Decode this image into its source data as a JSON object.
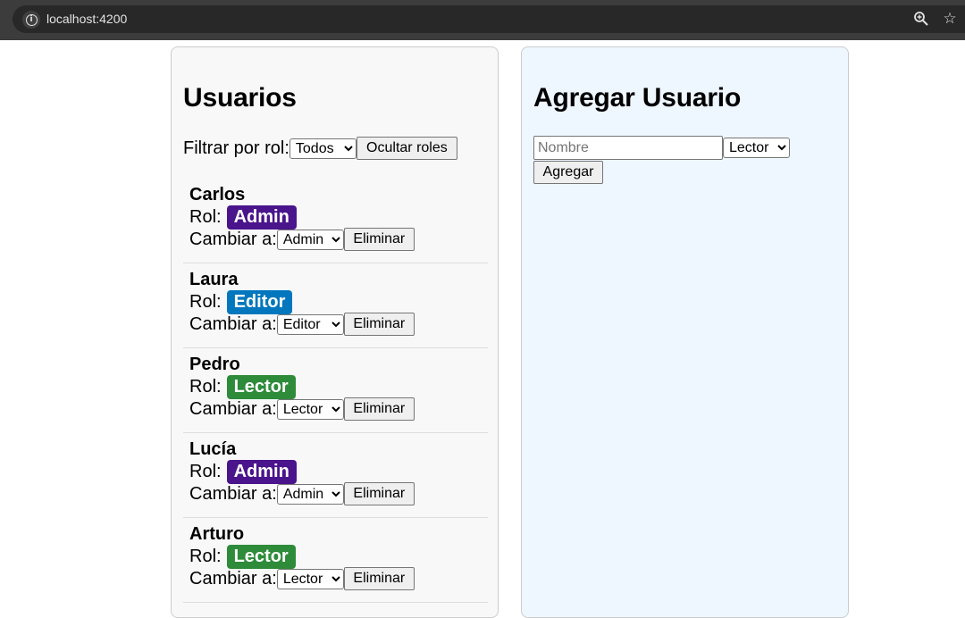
{
  "browser": {
    "url": "localhost:4200"
  },
  "users_panel": {
    "title": "Usuarios",
    "filter_label": "Filtrar por rol:",
    "filter_value": "Todos",
    "toggle_roles_label": "Ocultar roles",
    "role_prefix": "Rol:",
    "change_prefix": "Cambiar a:",
    "delete_label": "Eliminar",
    "users": [
      {
        "name": "Carlos",
        "role": "Admin",
        "role_key": "admin"
      },
      {
        "name": "Laura",
        "role": "Editor",
        "role_key": "editor"
      },
      {
        "name": "Pedro",
        "role": "Lector",
        "role_key": "lector"
      },
      {
        "name": "Lucía",
        "role": "Admin",
        "role_key": "admin"
      },
      {
        "name": "Arturo",
        "role": "Lector",
        "role_key": "lector"
      }
    ]
  },
  "add_panel": {
    "title": "Agregar Usuario",
    "name_placeholder": "Nombre",
    "role_value": "Lector",
    "submit_label": "Agregar"
  },
  "colors": {
    "admin": "#4a148c",
    "editor": "#0277bd",
    "lector": "#2e8b3a"
  },
  "icons": [
    "info-icon",
    "zoom-icon",
    "star-icon",
    "chevron-down-icon"
  ]
}
